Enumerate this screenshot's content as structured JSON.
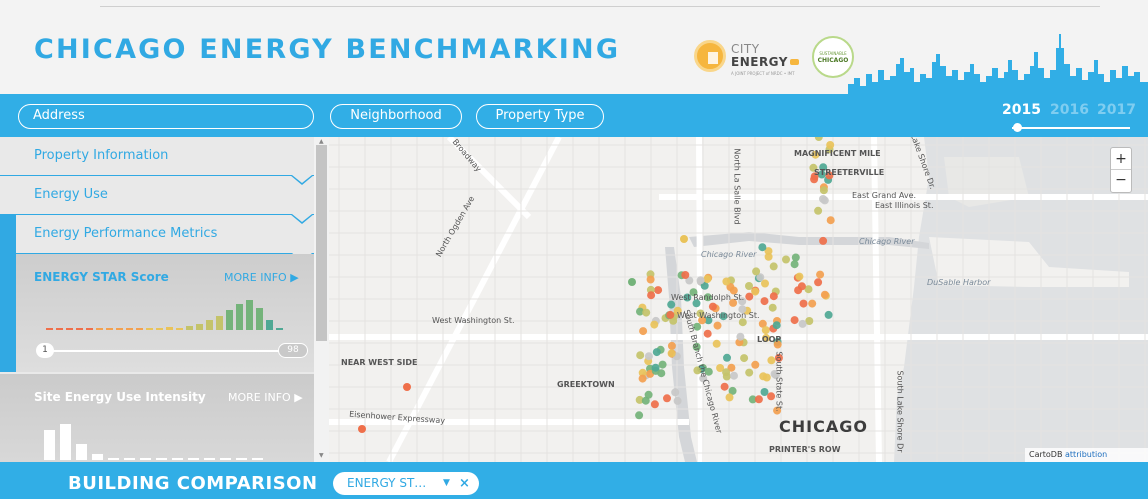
{
  "header": {
    "title": "CHICAGO ENERGY BENCHMARKING",
    "city_energy_logo": {
      "line1": "CITY",
      "line2": "ENERGY",
      "subtitle": "A JOINT PROJECT of NRDC • IMT"
    },
    "sustainable_chicago_logo": {
      "line1": "SUSTAINABLE",
      "line2": "CHICAGO"
    },
    "skyline_icon": "chicago-skyline",
    "accent_color": "#31a9e3"
  },
  "toolbar": {
    "address_label": "Address",
    "neighborhood_label": "Neighborhood",
    "property_type_label": "Property Type",
    "years": [
      "2015",
      "2016",
      "2017"
    ],
    "selected_year": "2015"
  },
  "sidebar": {
    "sections": [
      {
        "label": "Property Information"
      },
      {
        "label": "Energy Use"
      },
      {
        "label": "Energy Performance Metrics"
      }
    ],
    "energy_star": {
      "title": "ENERGY STAR Score",
      "more_info": "MORE INFO ▶",
      "range_min": "1",
      "range_max": "98"
    },
    "site_eui": {
      "title": "Site Energy Use Intensity",
      "more_info": "MORE INFO ▶"
    }
  },
  "map": {
    "labels": {
      "magnificent_mile": "MAGNIFICENT MILE",
      "streeterville": "STREETERVILLE",
      "east_grand": "East Grand Ave.",
      "east_illinois": "East Illinois St.",
      "chicago_river_1": "Chicago River",
      "chicago_river_2": "Chicago River",
      "dusable_harbor": "DuSable Harbor",
      "north_ogden": "North Ogden Ave",
      "north_lasalle": "North La Salle Blvd",
      "west_randolph": "West Randolph St.",
      "west_washington_1": "West Washington St.",
      "west_washington_2": "West Washington St.",
      "loop": "LOOP",
      "near_west_side": "NEAR WEST SIDE",
      "greektown": "GREEKTOWN",
      "eisenhower": "Eisenhower Expressway",
      "chicago": "CHICAGO",
      "printers_row": "PRINTER'S ROW",
      "south_state": "South State St.",
      "south_branch": "South Branch the Chicago River",
      "south_lake_shore": "South Lake Shore Dr",
      "north_lake_shore": "Lake Shore Dr.",
      "broadway": "Broadway"
    },
    "zoom_in": "+",
    "zoom_out": "−",
    "attribution_text": "CartoDB",
    "attribution_link": "attribution",
    "score_colors": {
      "low": "#ef6f4a",
      "mid_low": "#f3a04f",
      "mid": "#e9c35a",
      "mid_high": "#c4c36a",
      "high": "#74b37a",
      "teal": "#4fa894",
      "grey": "#c8c8c8"
    }
  },
  "bottom": {
    "title": "BUILDING COMPARISON",
    "chip_label": "ENERGY ST…",
    "chip_caret": "▼",
    "chip_remove": "×"
  }
}
